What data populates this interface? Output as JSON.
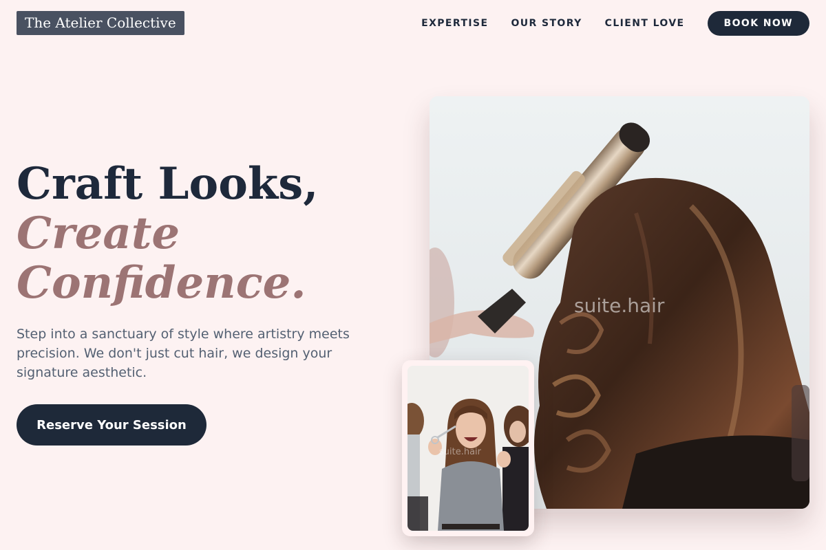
{
  "brand": {
    "name": "The Atelier Collective"
  },
  "nav": {
    "links": [
      "EXPERTISE",
      "OUR STORY",
      "CLIENT LOVE"
    ],
    "cta_label": "BOOK NOW"
  },
  "hero": {
    "headline_line1": "Craft Looks,",
    "headline_line2": "Create",
    "headline_line3": "Confidence.",
    "subtext": "Step into a sanctuary of style where artistry meets precision. We don't just cut hair, we design your signature aesthetic.",
    "cta_label": "Reserve Your Session",
    "image_watermark": "suite.hair",
    "inset_watermark": "suite.hair"
  },
  "colors": {
    "background": "#fdf2f2",
    "navy": "#1e2939",
    "accent_mauve": "#9c7474",
    "logo_bg": "#495161"
  }
}
